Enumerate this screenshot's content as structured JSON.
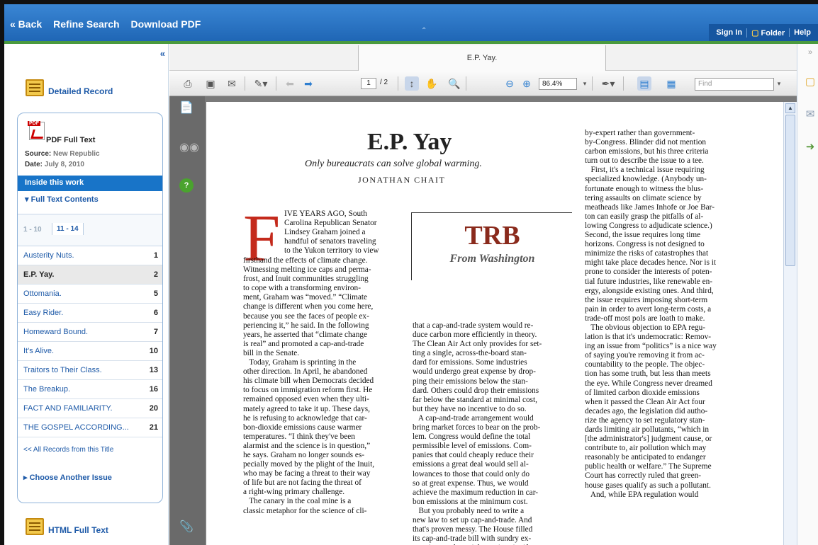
{
  "topbar": {
    "back": "« Back",
    "refine": "Refine Search",
    "download": "Download PDF",
    "sign_in": "Sign In",
    "folder": "Folder",
    "help": "Help"
  },
  "left": {
    "collapse": "«",
    "detailed_record": "Detailed Record",
    "pdf_full_text": "PDF Full Text",
    "source_label": "Source:",
    "source_value": "New Republic",
    "date_label": "Date:",
    "date_value": "July 8, 2010",
    "inside_this_work": "Inside this work",
    "full_text_contents": "Full Text Contents",
    "pager_1": "1 - 10",
    "pager_2": "11 - 14",
    "items": [
      {
        "title": "Austerity Nuts.",
        "page": "1"
      },
      {
        "title": "E.P. Yay.",
        "page": "2"
      },
      {
        "title": "Ottomania.",
        "page": "5"
      },
      {
        "title": "Easy Rider.",
        "page": "6"
      },
      {
        "title": "Homeward Bound.",
        "page": "7"
      },
      {
        "title": "It's Alive.",
        "page": "10"
      },
      {
        "title": "Traitors to Their Class.",
        "page": "13"
      },
      {
        "title": "The Breakup.",
        "page": "16"
      },
      {
        "title": "FACT AND FAMILIARITY.",
        "page": "20"
      },
      {
        "title": "THE GOSPEL ACCORDING...",
        "page": "21"
      }
    ],
    "all_records": "<< All Records from this Title",
    "choose_issue": "Choose Another Issue",
    "html_full_text": "HTML Full Text"
  },
  "viewer": {
    "tab_title": "E.P. Yay.",
    "page_current": "1",
    "page_total": "/ 2",
    "zoom": "86.4%",
    "find_placeholder": "Find"
  },
  "article": {
    "title": "E.P. Yay",
    "subtitle": "Only bureaucrats can solve global warming.",
    "author": "JONATHAN CHAIT",
    "dropcap": "F",
    "trb": "TRB",
    "trb_sub": "From Washington",
    "col1_top": "IVE YEARS AGO, South\nCarolina Republican Senator\nLindsey Graham joined a\nhandful of senators traveling\nto the Yukon territory to view",
    "col1": "firsthand the effects of climate change.\nWitnessing melting ice caps and perma-\nfrost, and Inuit communities struggling\nto cope with a transforming environ-\nment, Graham was “moved.” “Climate\nchange is different when you come here,\nbecause you see the faces of people ex-\nperiencing it,” he said. In the following\nyears, he asserted that “climate change\nis real” and promoted a cap-and-trade\nbill in the Senate.\n   Today, Graham is sprinting in the\nother direction. In April, he abandoned\nhis climate bill when Democrats decided\nto focus on immigration reform first. He\nremained opposed even when they ulti-\nmately agreed to take it up. These days,\nhe is refusing to acknowledge that car-\nbon-dioxide emissions cause warmer\ntemperatures. “I think they've been\nalarmist and the science is in question,”\nhe says. Graham no longer sounds es-\npecially moved by the plight of the Inuit,\nwho may be facing a threat to their way\nof life but are not facing the threat of\na right-wing primary challenge.\n   The canary in the coal mine is a\nclassic metaphor for the science of cli-",
    "col2": "that a cap-and-trade system would re-\nduce carbon more efficiently in theory.\nThe Clean Air Act only provides for set-\nting a single, across-the-board stan-\ndard for emissions. Some industries\nwould undergo great expense by drop-\nping their emissions below the stan-\ndard. Others could drop their emissions\nfar below the standard at minimal cost,\nbut they have no incentive to do so.\n   A cap-and-trade arrangement would\nbring market forces to bear on the prob-\nlem. Congress would define the total\npermissible level of emissions. Com-\npanies that could cheaply reduce their\nemissions a great deal would sell al-\nlowances to those that could only do\nso at great expense. Thus, we would\nachieve the maximum reduction in car-\nbon emissions at the minimum cost.\n   But you probably need to write a\nnew law to set up cap-and-trade. And\nthat's proven messy. The House filled\nits cap-and-trade bill with sundry ex-\nemptions and special permits, signif-\nicantly dampening its efficiency. The",
    "col3": "by-expert rather than government-\nby-Congress. Blinder did not mention\ncarbon emissions, but his three criteria\nturn out to describe the issue to a tee.\n   First, it's a technical issue requiring\nspecialized knowledge. (Anybody un-\nfortunate enough to witness the blus-\ntering assaults on climate science by\nmeatheads like James Inhofe or Joe Bar-\nton can easily grasp the pitfalls of al-\nlowing Congress to adjudicate science.)\nSecond, the issue requires long time\nhorizons. Congress is not designed to\nminimize the risks of catastrophes that\nmight take place decades hence. Nor is it\nprone to consider the interests of poten-\ntial future industries, like renewable en-\nergy, alongside existing ones. And third,\nthe issue requires imposing short-term\npain in order to avert long-term costs, a\ntrade-off most pols are loath to make.\n   The obvious objection to EPA regu-\nlation is that it's undemocratic: Remov-\ning an issue from “politics” is a nice way\nof saying you're removing it from ac-\ncountability to the people. The objec-\ntion has some truth, but less than meets\nthe eye. While Congress never dreamed\nof limited carbon dioxide emissions\nwhen it passed the Clean Air Act four\ndecades ago, the legislation did autho-\nrize the agency to set regulatory stan-\ndards limiting air pollutants, “which in\n[the administrator's] judgment cause, or\ncontribute to, air pollution which may\nreasonably be anticipated to endanger\npublic health or welfare.” The Supreme\nCourt has correctly ruled that green-\nhouse gases qualify as such a pollutant.\n   And, while EPA regulation would"
  }
}
